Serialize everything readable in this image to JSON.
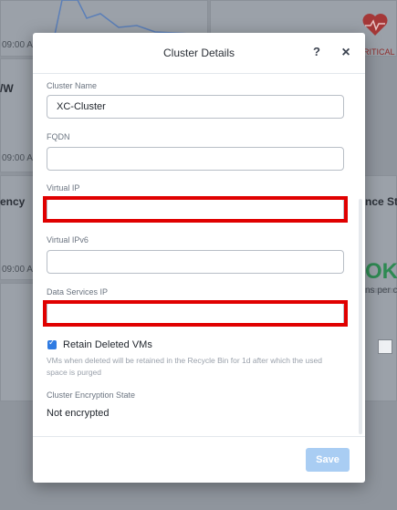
{
  "background": {
    "time_labels": [
      "09:00 A",
      "09:00 A",
      "09:00 A"
    ],
    "panel_labels": {
      "left_top": "/W",
      "left_mid": "ency",
      "right_mid": "nce Sta",
      "status_ok": "OK",
      "status_sub": "ns per c",
      "critical": "RITICAL"
    }
  },
  "dialog": {
    "title": "Cluster Details",
    "help_label": "?",
    "close_label": "×",
    "fields": {
      "cluster_name": {
        "label": "Cluster Name",
        "value": "XC-Cluster"
      },
      "fqdn": {
        "label": "FQDN",
        "value": ""
      },
      "virtual_ip": {
        "label": "Virtual IP",
        "value": ""
      },
      "virtual_ipv6": {
        "label": "Virtual IPv6",
        "value": ""
      },
      "data_services_ip": {
        "label": "Data Services IP",
        "value": ""
      }
    },
    "retain": {
      "label": "Retain Deleted VMs",
      "checked": true,
      "help": "VMs when deleted will be retained in the Recycle Bin for 1d after which the used space is purged"
    },
    "encryption": {
      "label": "Cluster Encryption State",
      "value": "Not encrypted"
    },
    "save_label": "Save",
    "colors": {
      "accent": "#2f7be2",
      "save_disabled": "#a9cdf3",
      "highlight": "#e00000"
    }
  }
}
